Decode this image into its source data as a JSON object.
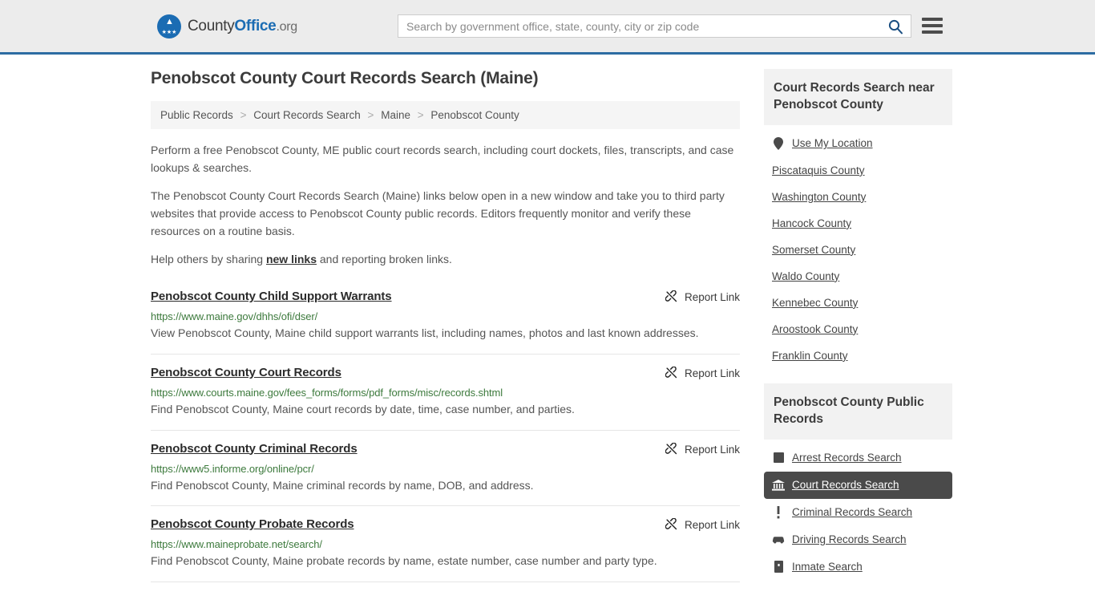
{
  "header": {
    "brand": {
      "part1": "County",
      "part2": "Office",
      "part3": ".org"
    },
    "search": {
      "placeholder": "Search by government office, state, county, city or zip code",
      "value": ""
    },
    "menu_label": "menu"
  },
  "page": {
    "title": "Penobscot County Court Records Search (Maine)"
  },
  "breadcrumb": {
    "items": [
      {
        "label": "Public Records"
      },
      {
        "label": "Court Records Search"
      },
      {
        "label": "Maine"
      },
      {
        "label": "Penobscot County"
      }
    ],
    "separator": ">"
  },
  "intro": {
    "p1": "Perform a free Penobscot County, ME public court records search, including court dockets, files, transcripts, and case lookups & searches.",
    "p2": "The Penobscot County Court Records Search (Maine) links below open in a new window and take you to third party websites that provide access to Penobscot County public records. Editors frequently monitor and verify these resources on a routine basis.",
    "p3_before": "Help others by sharing ",
    "p3_link": "new links",
    "p3_after": " and reporting broken links."
  },
  "results": {
    "report_label": "Report Link",
    "items": [
      {
        "title": "Penobscot County Child Support Warrants",
        "url": "https://www.maine.gov/dhhs/ofi/dser/",
        "description": "View Penobscot County, Maine child support warrants list, including names, photos and last known addresses."
      },
      {
        "title": "Penobscot County Court Records",
        "url": "https://www.courts.maine.gov/fees_forms/forms/pdf_forms/misc/records.shtml",
        "description": "Find Penobscot County, Maine court records by date, time, case number, and parties."
      },
      {
        "title": "Penobscot County Criminal Records",
        "url": "https://www5.informe.org/online/pcr/",
        "description": "Find Penobscot County, Maine criminal records by name, DOB, and address."
      },
      {
        "title": "Penobscot County Probate Records",
        "url": "https://www.maineprobate.net/search/",
        "description": "Find Penobscot County, Maine probate records by name, estate number, case number and party type."
      }
    ]
  },
  "sidebar": {
    "nearby": {
      "heading": "Court Records Search near Penobscot County",
      "items": [
        {
          "label": "Use My Location",
          "icon": "map-pin-icon",
          "has_icon": true
        },
        {
          "label": "Piscataquis County",
          "has_icon": false
        },
        {
          "label": "Washington County",
          "has_icon": false
        },
        {
          "label": "Hancock County",
          "has_icon": false
        },
        {
          "label": "Somerset County",
          "has_icon": false
        },
        {
          "label": "Waldo County",
          "has_icon": false
        },
        {
          "label": "Kennebec County",
          "has_icon": false
        },
        {
          "label": "Aroostook County",
          "has_icon": false
        },
        {
          "label": "Franklin County",
          "has_icon": false
        }
      ]
    },
    "public_records": {
      "heading": "Penobscot County Public Records",
      "items": [
        {
          "label": "Arrest Records Search",
          "icon": "fingerprint-icon",
          "active": false
        },
        {
          "label": "Court Records Search",
          "icon": "courthouse-icon",
          "active": true
        },
        {
          "label": "Criminal Records Search",
          "icon": "exclamation-icon",
          "active": false
        },
        {
          "label": "Driving Records Search",
          "icon": "car-icon",
          "active": false
        },
        {
          "label": "Inmate Search",
          "icon": "jail-icon",
          "active": false
        }
      ]
    }
  },
  "colors": {
    "brand_blue": "#1b6cb3",
    "header_bg": "#ececec",
    "header_border": "#2d6ca2",
    "url_green": "#3d7a3d",
    "active_bg": "#4a4a4a"
  }
}
